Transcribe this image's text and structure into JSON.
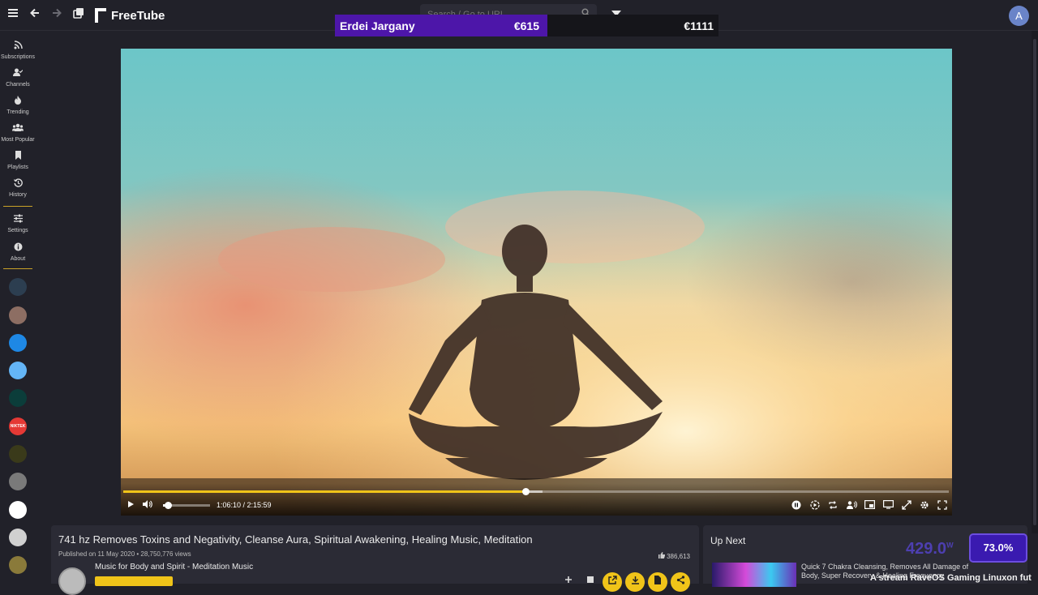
{
  "app": {
    "name": "FreeTube"
  },
  "topbar": {
    "search_placeholder": "Search / Go to URL",
    "avatar_letter": "A"
  },
  "overlay": {
    "name": "Erdei Jargany",
    "amount1": "€615",
    "amount2": "€1111"
  },
  "sidebar": {
    "items": [
      {
        "label": "Subscriptions",
        "icon": "rss-icon"
      },
      {
        "label": "Channels",
        "icon": "user-check-icon"
      },
      {
        "label": "Trending",
        "icon": "fire-icon"
      },
      {
        "label": "Most Popular",
        "icon": "users-icon"
      },
      {
        "label": "Playlists",
        "icon": "bookmark-icon"
      },
      {
        "label": "History",
        "icon": "history-icon"
      },
      {
        "label": "Settings",
        "icon": "sliders-icon"
      },
      {
        "label": "About",
        "icon": "info-icon"
      }
    ],
    "channel_avatar_colors": [
      "#2c3e50",
      "#8d6e63",
      "#1e88e5",
      "#64b5f6",
      "#0b3d3a",
      "#e53935",
      "#3a3a1a",
      "#7a7a7a",
      "#ffffff",
      "#d0d0d0",
      "#8a7a3a"
    ],
    "channel_avatar_text": "NIKTEK"
  },
  "player": {
    "time": "1:06:10 / 2:15:59",
    "progress": 0.487,
    "buffered": 0.508,
    "volume": 0.05
  },
  "video": {
    "title": "741 hz Removes Toxins and Negativity, Cleanse Aura, Spiritual Awakening, Healing Music, Meditation",
    "published": "Published on 11 May 2020 • 28,750,776 views",
    "likes": "386,613",
    "channel": "Music for Body and Spirit - Meditation Music"
  },
  "upnext": {
    "title": "Up Next",
    "item_title": "Quick 7 Chakra Cleansing, Removes All Damage of Body, Super Recovery & Healing Frequency"
  },
  "stats": {
    "watts": "429.0",
    "watts_unit": "W",
    "percent": "73.0%",
    "ticker": "A stream RaveOS Gaming Linuxon fut"
  },
  "colors": {
    "accent": "#f0c419",
    "bg": "#212129",
    "overlay_purple": "#4d16a9"
  }
}
